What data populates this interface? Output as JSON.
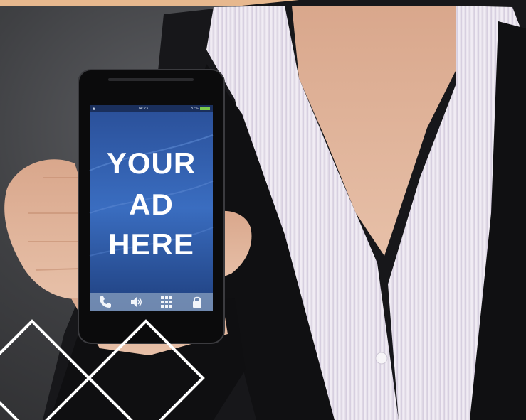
{
  "ad": {
    "line1": "YOUR",
    "line2": "AD",
    "line3": "HERE"
  },
  "status_bar": {
    "time": "14:23",
    "battery": "87%"
  },
  "dock_icons": [
    "phone-icon",
    "speaker-icon",
    "keypad-icon",
    "lock-icon"
  ],
  "colors": {
    "top_band": "#e7b88e",
    "screen_blue": "#2f5fb0",
    "suit": "#151517",
    "shirt": "#ece7f0",
    "skin": "#e9bfa7",
    "outline": "#ffffff"
  }
}
